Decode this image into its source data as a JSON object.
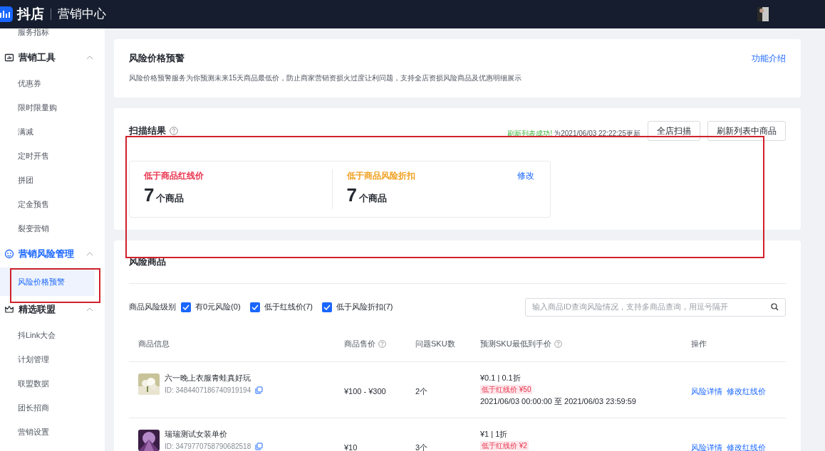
{
  "header": {
    "logo": "抖店",
    "product": "营销中心"
  },
  "sidebar": [
    {
      "kind": "item",
      "label": "服务指标",
      "selected": false
    },
    {
      "kind": "group",
      "label": "营销工具",
      "active": false,
      "expanded": true
    },
    {
      "kind": "item",
      "label": "优惠券",
      "selected": false
    },
    {
      "kind": "item",
      "label": "限时限量购",
      "selected": false
    },
    {
      "kind": "item",
      "label": "满减",
      "selected": false
    },
    {
      "kind": "item",
      "label": "定时开售",
      "selected": false
    },
    {
      "kind": "item",
      "label": "拼团",
      "selected": false
    },
    {
      "kind": "item",
      "label": "定金预售",
      "selected": false
    },
    {
      "kind": "item",
      "label": "裂变营销",
      "selected": false
    },
    {
      "kind": "group",
      "label": "营销风险管理",
      "active": true,
      "expanded": true
    },
    {
      "kind": "item",
      "label": "风险价格预警",
      "selected": true
    },
    {
      "kind": "group",
      "label": "精选联盟",
      "active": false,
      "expanded": true
    },
    {
      "kind": "item",
      "label": "抖Link大会",
      "selected": false
    },
    {
      "kind": "item",
      "label": "计划管理",
      "selected": false
    },
    {
      "kind": "item",
      "label": "联盟数据",
      "selected": false
    },
    {
      "kind": "item",
      "label": "团长招商",
      "selected": false
    },
    {
      "kind": "item",
      "label": "营销设置",
      "selected": false
    }
  ],
  "intro": {
    "title": "风险价格预警",
    "link": "功能介绍",
    "description": "风险价格预警服务为你预测未来15天商品最低价，防止商家营销资损火过度让利问题，支持全店资损风险商品及优惠明细展示"
  },
  "scan": {
    "title": "扫描结果",
    "status": "刷新列表成功!",
    "updated": "为2021/06/03 22:22:25更新",
    "buttons": [
      "全店扫描",
      "刷新列表中商品"
    ],
    "stats": [
      {
        "label": "低于商品红线价",
        "color": "#e8364f",
        "count": "7",
        "unit": "个商品"
      },
      {
        "label": "低于商品风险折扣",
        "color": "#f0a020",
        "count": "7",
        "unit": "个商品"
      }
    ],
    "edit_link": "修改"
  },
  "risk": {
    "title": "风险商品",
    "filter_label": "商品风险级别",
    "filters": [
      {
        "label": "有0元风险(0)",
        "checked": true
      },
      {
        "label": "低于红线价(7)",
        "checked": true
      },
      {
        "label": "低于风险折扣(7)",
        "checked": true
      }
    ],
    "search": {
      "placeholder": "输入商品ID查询风险情况，支持多商品查询，用逗号隔开"
    },
    "columns": [
      "商品信息",
      "商品售价",
      "问题SKU数",
      "预测SKU最低到手价",
      "操作"
    ],
    "rows": [
      {
        "name": "六一晚上衣服青蛙真好玩",
        "id": "ID: 3484407186740919194",
        "price": "¥100 - ¥300",
        "sku": "2个",
        "forecast": "¥0.1 | 0.1折",
        "tag": "低于红线价 ¥50",
        "range": "2021/06/03 00:00:00 至 2021/06/03 23:59:59",
        "actions": [
          "风险详情",
          "修改红线价"
        ]
      },
      {
        "name": "瑞瑞测试女装单价",
        "id": "ID: 3479770758790682518",
        "price": "¥10",
        "sku": "3个",
        "forecast": "¥1 | 1折",
        "tag": "低于红线价 ¥2",
        "actions": [
          "风险详情",
          "修改红线价"
        ]
      }
    ]
  }
}
